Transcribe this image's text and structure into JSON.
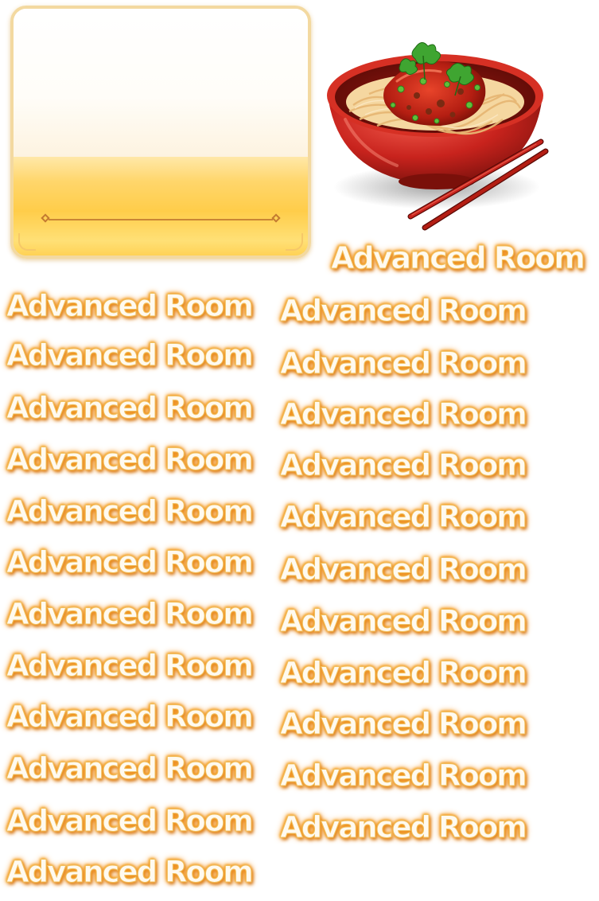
{
  "labels": {
    "top": "Advanced Room",
    "left_column": [
      "Advanced Room",
      "Advanced Room",
      "Advanced Room",
      "Advanced Room",
      "Advanced Room",
      "Advanced Room",
      "Advanced Room",
      "Advanced Room",
      "Advanced Room",
      "Advanced Room",
      "Advanced Room",
      "Advanced Room"
    ],
    "right_column": [
      "Advanced Room",
      "Advanced Room",
      "Advanced Room",
      "Advanced Room",
      "Advanced Room",
      "Advanced Room",
      "Advanced Room",
      "Advanced Room",
      "Advanced Room",
      "Advanced Room",
      "Advanced Room"
    ]
  },
  "colors": {
    "card_gold": "#ffd35c",
    "card_border": "#f3d9a0",
    "label_fill": "#fffaf0",
    "label_glow": "#f39a26",
    "bowl_red": "#c8231d"
  },
  "icons": {
    "card": "room-card-frame",
    "bowl": "noodle-bowl-icon"
  }
}
